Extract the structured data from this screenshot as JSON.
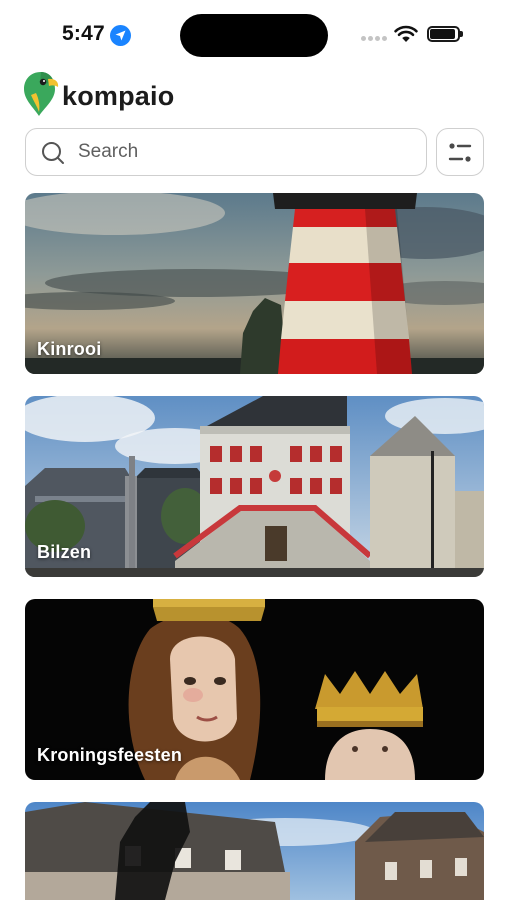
{
  "status_bar": {
    "time": "5:47",
    "location_icon": "location-arrow-icon",
    "signal_icon": "signal-dots-icon",
    "wifi_icon": "wifi-icon",
    "battery_icon": "battery-icon"
  },
  "brand": {
    "name": "kompaio",
    "logo_icon": "parrot-pin-logo"
  },
  "search": {
    "placeholder": "Search",
    "value": "",
    "icon": "search-icon",
    "filter_icon": "filter-icon"
  },
  "cards": [
    {
      "title": "Kinrooi",
      "scene": "lighthouse"
    },
    {
      "title": "Bilzen",
      "scene": "town-hall"
    },
    {
      "title": "Kroningsfeesten",
      "scene": "crowned-statues"
    },
    {
      "title": "",
      "scene": "town-square"
    }
  ],
  "colors": {
    "accent_blue": "#1a84ff",
    "border": "#cfcfcf",
    "text_dark": "#1c1c1c",
    "logo_green": "#3aa85c",
    "logo_yellow": "#f2c230"
  }
}
